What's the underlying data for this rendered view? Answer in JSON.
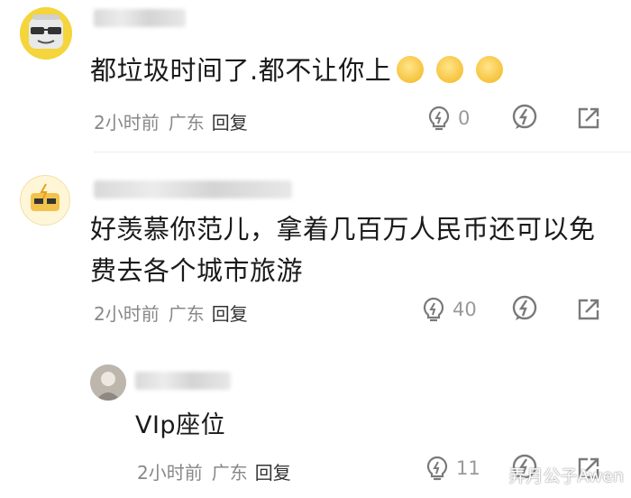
{
  "comments": [
    {
      "text": "都垃圾时间了.都不让你上",
      "time": "2小时前",
      "location": "广东",
      "reply_label": "回复",
      "like_count": "0",
      "avatar_icon": "sunglasses-face-icon",
      "emoji_icon": "grinning-face-emoji-icon"
    },
    {
      "text_line1": "好羡慕你范儿，拿着几百万人民币还可以免",
      "text_line2": "费去各个城市旅游",
      "time": "2小时前",
      "location": "广东",
      "reply_label": "回复",
      "like_count": "40",
      "avatar_icon": "lightning-badge-icon"
    },
    {
      "text": "VIp座位",
      "time": "2小时前",
      "location": "广东",
      "reply_label": "回复",
      "like_count": "11",
      "avatar_icon": "user-photo-icon"
    }
  ],
  "watermark": "弄月公子Awen",
  "icons": {
    "like": "lightbulb-like-icon",
    "reply_bubble": "lightning-bubble-icon",
    "share": "share-arrow-icon"
  },
  "colors": {
    "meta_text": "#888888",
    "comment_text": "#1a1a1a",
    "icon_gray": "#7a7a7a"
  }
}
